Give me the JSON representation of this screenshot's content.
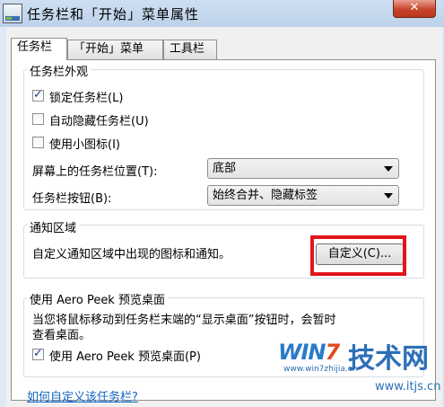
{
  "window": {
    "title": "任务栏和「开始」菜单属性",
    "close_glyph": "✕"
  },
  "tabs": [
    {
      "label": "任务栏",
      "active": true
    },
    {
      "label": "「开始」菜单",
      "active": false
    },
    {
      "label": "工具栏",
      "active": false
    }
  ],
  "appearance": {
    "group_label": "任务栏外观",
    "lock_taskbar": {
      "label": "锁定任务栏(L)",
      "checked": true
    },
    "auto_hide": {
      "label": "自动隐藏任务栏(U)",
      "checked": false
    },
    "small_icons": {
      "label": "使用小图标(I)",
      "checked": false
    },
    "location": {
      "label": "屏幕上的任务栏位置(T):",
      "value": "底部"
    },
    "buttons": {
      "label": "任务栏按钮(B):",
      "value": "始终合并、隐藏标签"
    }
  },
  "notification": {
    "group_label": "通知区域",
    "description": "自定义通知区域中出现的图标和通知。",
    "customize_button": "自定义(C)..."
  },
  "aero_peek": {
    "group_label": "使用 Aero Peek 预览桌面",
    "description_line1": "当您将鼠标移动到任务栏末端的“显示桌面”按钮时，会暂时",
    "description_line2": "查看桌面。",
    "checkbox": {
      "label": "使用 Aero Peek 预览桌面(P)",
      "checked": true
    }
  },
  "help_link": "如何自定义该任务栏?",
  "watermark": {
    "logo": "WIN7",
    "big_text": "技术网",
    "url_small": "www.win7zhijia.cn",
    "url": "www.itjs.cn"
  },
  "colors": {
    "highlight": "#e2141c",
    "link": "#1565c0",
    "accent": "#2d6fb8"
  }
}
